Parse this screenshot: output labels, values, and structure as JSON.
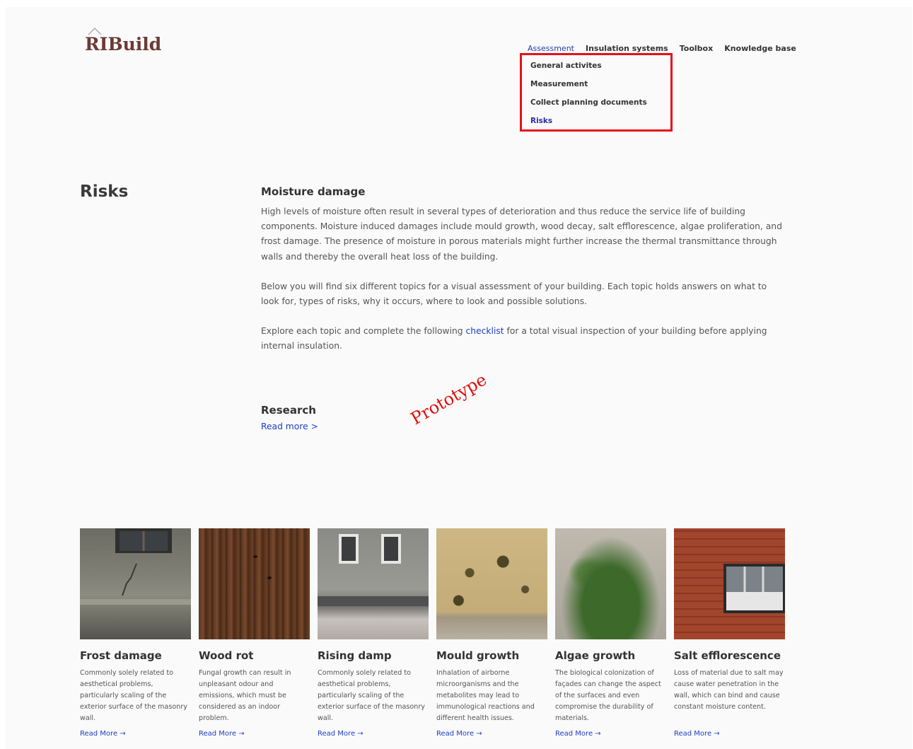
{
  "brand": {
    "logo_text": "RIBuild"
  },
  "nav": {
    "items": [
      {
        "label": "Assessment",
        "active": true
      },
      {
        "label": "Insulation systems",
        "active": false
      },
      {
        "label": "Toolbox",
        "active": false
      },
      {
        "label": "Knowledge base",
        "active": false
      }
    ],
    "dropdown": [
      {
        "label": "General activites",
        "active": false
      },
      {
        "label": "Measurement",
        "active": false
      },
      {
        "label": "Collect planning documents",
        "active": false
      },
      {
        "label": "Risks",
        "active": true
      }
    ]
  },
  "page": {
    "title": "Risks"
  },
  "main": {
    "heading": "Moisture damage",
    "para1": "High levels of moisture often result in several types of deterioration and thus reduce the service life of building components. Moisture induced damages include mould growth, wood decay, salt efflorescence, algae proliferation, and frost damage. The presence of moisture in porous materials might further increase the thermal transmittance through walls and thereby the overall heat loss of the building.",
    "para2": "Below you will find six different topics for a visual assessment of your building. Each topic holds answers on what to look for, types of risks, why it occurs, where to look and possible solutions.",
    "para3_before": "Explore each topic and complete the following ",
    "para3_link": "checklist",
    "para3_after": " for a total visual inspection of your building before applying internal insulation."
  },
  "research": {
    "heading": "Research",
    "link": "Read more >"
  },
  "watermark": "Prototype",
  "cards": [
    {
      "title": "Frost damage",
      "desc": "Commonly solely related to aesthetical problems, particularly scaling of the exterior surface of the masonry wall.",
      "more": "Read More →"
    },
    {
      "title": "Wood rot",
      "desc": "Fungal growth can result in unpleasant odour and emissions, which must be considered as an indoor problem.",
      "more": "Read More →"
    },
    {
      "title": "Rising damp",
      "desc": "Commonly solely related to aesthetical problems, particularly scaling of the exterior surface of the masonry wall.",
      "more": "Read More →"
    },
    {
      "title": "Mould growth",
      "desc": "Inhalation of airborne microorganisms and the metabolites may lead to immunological reactions and different health issues.",
      "more": "Read More →"
    },
    {
      "title": "Algae growth",
      "desc": "The biological colonization of façades can change the aspect of the surfaces and even compromise the durability of materials.",
      "more": "Read More →"
    },
    {
      "title": "Salt efflorescence",
      "desc": "Loss of material due to salt may cause water penetration in the wall, which can bind and cause constant moisture content.",
      "more": "Read More →"
    }
  ],
  "colors": {
    "accent_link": "#1e3fc4",
    "highlight_border": "#e8101a",
    "logo": "#6b3a35",
    "watermark": "#e10e0e"
  }
}
